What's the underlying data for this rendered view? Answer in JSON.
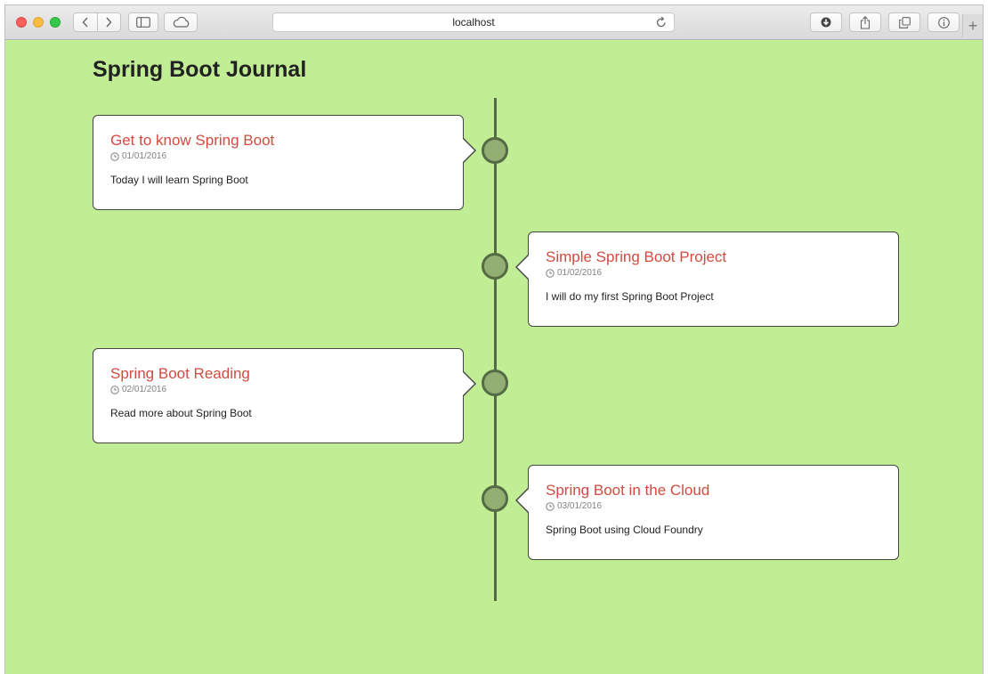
{
  "browser": {
    "address": "localhost",
    "new_tab_label": "+"
  },
  "page": {
    "title": "Spring Boot Journal"
  },
  "entries": [
    {
      "title": "Get to know Spring Boot",
      "date": "01/01/2016",
      "summary": "Today I will learn Spring Boot",
      "side": "left"
    },
    {
      "title": "Simple Spring Boot Project",
      "date": "01/02/2016",
      "summary": "I will do my first Spring Boot Project",
      "side": "right"
    },
    {
      "title": "Spring Boot Reading",
      "date": "02/01/2016",
      "summary": "Read more about Spring Boot",
      "side": "left"
    },
    {
      "title": "Spring Boot in the Cloud",
      "date": "03/01/2016",
      "summary": "Spring Boot using Cloud Foundry",
      "side": "right"
    }
  ],
  "colors": {
    "page_background": "#c1ed95",
    "entry_title": "#d24a40",
    "timeline": "#546b45",
    "timeline_node": "#93ae73"
  },
  "icons": {
    "date": "clock-icon",
    "reload": "reload-icon",
    "downloads": "download-icon",
    "share": "share-icon",
    "tabs": "tabs-overview-icon",
    "info": "info-icon"
  }
}
